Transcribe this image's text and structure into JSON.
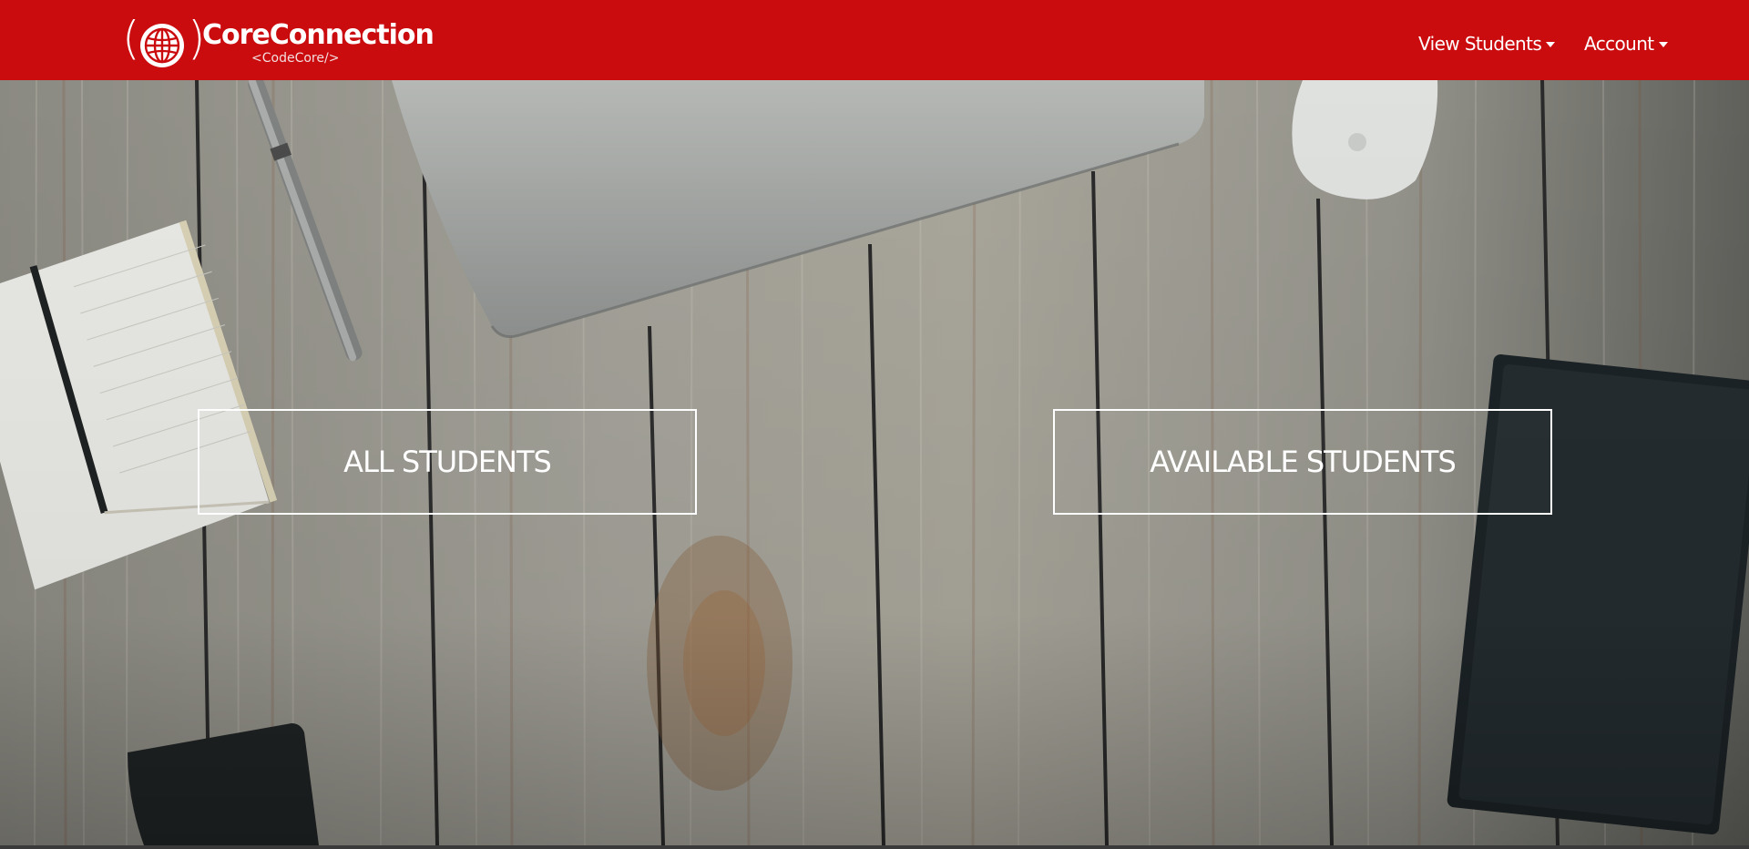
{
  "brand": {
    "name": "CoreConnection",
    "sub": "<CodeCore/>",
    "logo_icon": "globe-icon"
  },
  "nav": {
    "view_students": "View Students",
    "account": "Account"
  },
  "hero": {
    "background_image": "wooden-desk-with-laptop-notebook-pen-mouse-book-photo",
    "buttons": {
      "all_students": "ALL STUDENTS",
      "available_students": "AVAILABLE STUDENTS"
    }
  },
  "colors": {
    "navbar": "#cb0c0f",
    "button_border": "#ffffff",
    "text": "#ffffff"
  }
}
